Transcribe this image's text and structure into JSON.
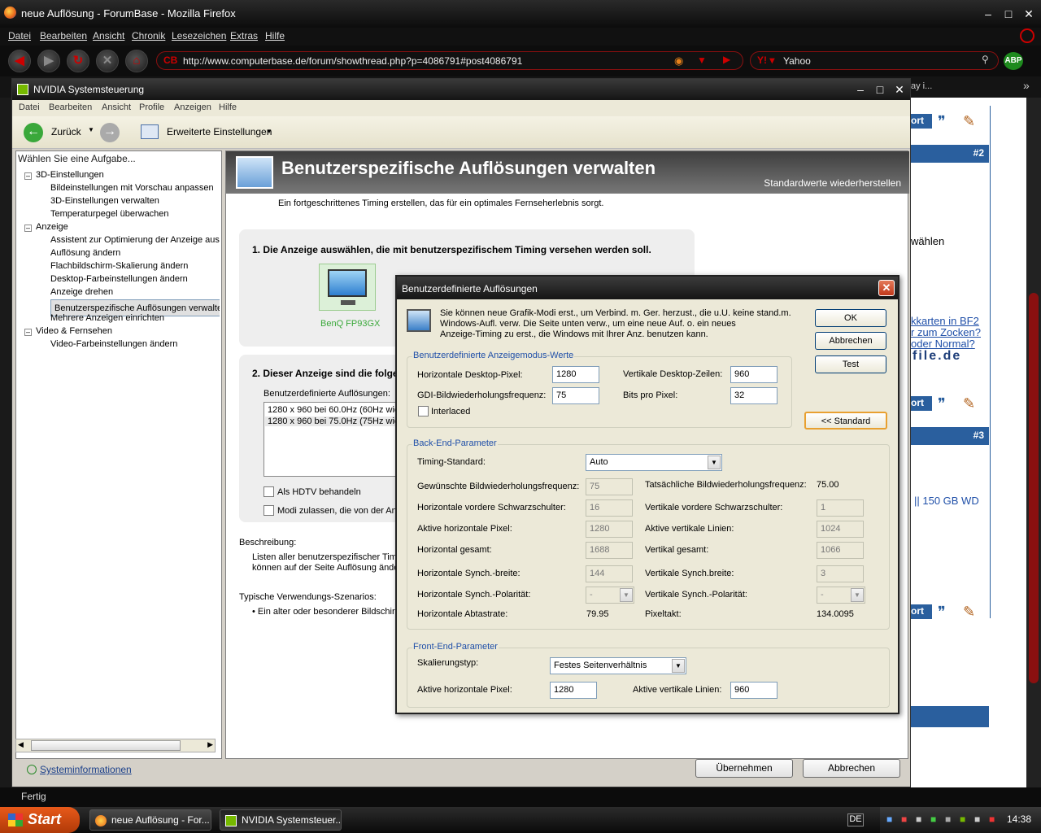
{
  "firefox": {
    "title": "neue Auflösung - ForumBase - Mozilla Firefox",
    "menu": [
      "Datei",
      "Bearbeiten",
      "Ansicht",
      "Chronik",
      "Lesezeichen",
      "Extras",
      "Hilfe"
    ],
    "url": "http://www.computerbase.de/forum/showthread.php?p=4086791#post4086791",
    "search_engine": "Yahoo",
    "abp_label": "ABP",
    "status": "Fertig",
    "tab_overflow": "ay i..."
  },
  "page": {
    "post2": "#2",
    "post3": "#3",
    "text_waehlen": "wählen",
    "link1": "kkarten in BF2",
    "link2": "r zum Zocken?",
    "link3": "oder Normal?",
    "brand": "file.de",
    "link4": "|| 150 GB WD",
    "port_label": "ort"
  },
  "taskbar": {
    "start": "Start",
    "items": [
      "neue Auflösung - For...",
      "NVIDIA Systemsteuer..."
    ],
    "lang": "DE",
    "clock": "14:38"
  },
  "nvidia": {
    "title": "NVIDIA Systemsteuerung",
    "menu": [
      "Datei",
      "Bearbeiten",
      "Ansicht",
      "Profile",
      "Anzeigen",
      "Hilfe"
    ],
    "back_label": "Zurück",
    "view_label": "Erweiterte Einstellungen",
    "tasks_header": "Wählen Sie eine Aufgabe...",
    "tree": [
      "3D-Einstellungen",
      "Bildeinstellungen mit Vorschau anpassen",
      "3D-Einstellungen verwalten",
      "Temperaturpegel überwachen",
      "Anzeige",
      "Assistent zur Optimierung der Anzeige aus",
      "Auflösung ändern",
      "Flachbildschirm-Skalierung ändern",
      "Desktop-Farbeinstellungen ändern",
      "Anzeige drehen",
      "Benutzerspezifische Auflösungen verwalten",
      "Mehrere Anzeigen einrichten",
      "Video & Fernsehen",
      "Video-Farbeinstellungen ändern"
    ],
    "sysinfo": "Systeminformationen",
    "banner_title": "Benutzerspezifische Auflösungen verwalten",
    "banner_link": "Standardwerte wiederherstellen",
    "intro": "Ein fortgeschrittenes Timing erstellen, das für ein optimales Fernseherlebnis sorgt.",
    "step1": "1. Die Anzeige auswählen, die mit benutzerspezifischem Timing versehen werden soll.",
    "monitor_name": "BenQ FP93GX",
    "step2": "2. Dieser Anzeige sind die folgen",
    "custom_res_label": "Benutzerdefinierte Auflösungen:",
    "res_list": [
      "1280 x 960 bei 60.0Hz (60Hz wie",
      "1280 x 960 bei 75.0Hz (75Hz wie"
    ],
    "hdtv_label": "Als HDTV behandeln",
    "modes_label": "Modi zulassen, die von der Anz",
    "desc_label": "Beschreibung:",
    "desc_text1": "Listen aller benutzerspezifischer Timin",
    "desc_text2": "können auf der Seite Auflösung ände",
    "usage_label": "Typische Verwendungs-Szenarios:",
    "usage_item": "• Ein alter oder besonderer Bildschirm",
    "apply": "Übernehmen",
    "cancel": "Abbrechen"
  },
  "dialog": {
    "title": "Benutzerdefinierte Auflösungen",
    "info": [
      "Sie können neue Grafik-Modi erst., um Verbind. m. Ger. herzust., die u.U. keine stand.m.",
      "Windows-Aufl. verw. Die Seite unten verw., um eine neue Auf. o. ein neues",
      "Anzeige-Timing zu erst., die Windows mit Ihrer Anz. benutzen kann."
    ],
    "ok": "OK",
    "cancel": "Abbrechen",
    "test": "Test",
    "standard": "<< Standard",
    "grp1": "Benutzerdefinierte Anzeigemodus-Werte",
    "h_pixels_label": "Horizontale Desktop-Pixel:",
    "h_pixels": "1280",
    "v_lines_label": "Vertikale Desktop-Zeilen:",
    "v_lines": "960",
    "gdi_label": "GDI-Bildwiederholungsfrequenz:",
    "gdi": "75",
    "bpp_label": "Bits pro Pixel:",
    "bpp": "32",
    "interlaced": "Interlaced",
    "grp2": "Back-End-Parameter",
    "timing_label": "Timing-Standard:",
    "timing": "Auto",
    "req_refresh_label": "Gewünschte Bildwiederholungsfrequenz:",
    "req_refresh": "75",
    "actual_refresh_label": "Tatsächliche Bildwiederholungsfrequenz:",
    "actual_refresh": "75.00",
    "h_front_label": "Horizontale vordere Schwarzschulter:",
    "h_front": "16",
    "v_front_label": "Vertikale vordere Schwarzschulter:",
    "v_front": "1",
    "h_active_label": "Aktive horizontale Pixel:",
    "h_active": "1280",
    "v_active_label": "Aktive vertikale Linien:",
    "v_active": "1024",
    "h_total_label": "Horizontal gesamt:",
    "h_total": "1688",
    "v_total_label": "Vertikal gesamt:",
    "v_total": "1066",
    "h_sync_label": "Horizontale Synch.-breite:",
    "h_sync": "144",
    "v_sync_label": "Vertikale Synch.breite:",
    "v_sync": "3",
    "h_pol_label": "Horizontale Synch.-Polarität:",
    "h_pol": "-",
    "v_pol_label": "Vertikale Synch.-Polarität:",
    "v_pol": "-",
    "h_scan_label": "Horizontale Abtastrate:",
    "h_scan": "79.95",
    "pixclk_label": "Pixeltakt:",
    "pixclk": "134.0095",
    "grp3": "Front-End-Parameter",
    "scale_label": "Skalierungstyp:",
    "scale": "Festes Seitenverhältnis",
    "fe_h_label": "Aktive horizontale Pixel:",
    "fe_h": "1280",
    "fe_v_label": "Aktive vertikale Linien:",
    "fe_v": "960"
  }
}
